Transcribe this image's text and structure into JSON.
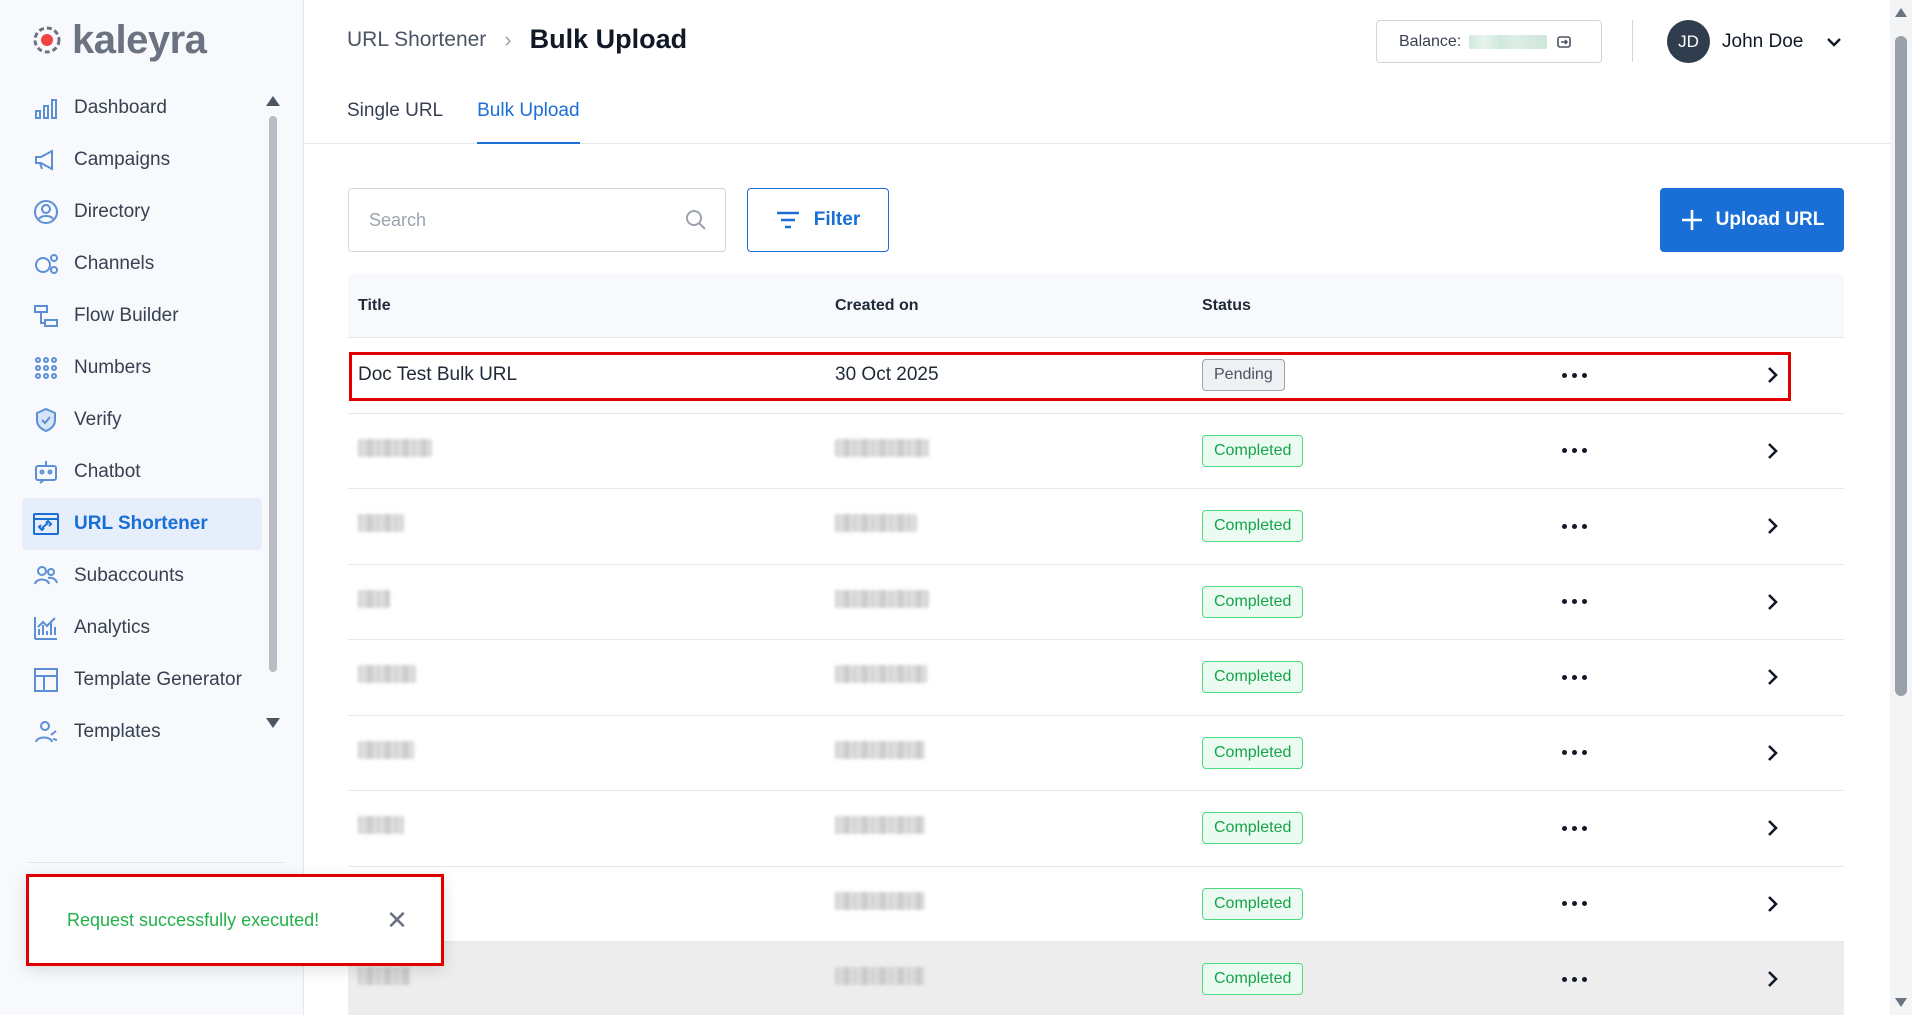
{
  "brand": {
    "name": "kaleyra",
    "accent": "#1a6fd6",
    "highlight": "#e00000"
  },
  "sidebar": {
    "items": [
      {
        "label": "Dashboard",
        "icon": "bar-chart-icon",
        "active": false
      },
      {
        "label": "Campaigns",
        "icon": "megaphone-icon",
        "active": false
      },
      {
        "label": "Directory",
        "icon": "person-circle-icon",
        "active": false
      },
      {
        "label": "Channels",
        "icon": "channels-icon",
        "active": false
      },
      {
        "label": "Flow Builder",
        "icon": "flow-icon",
        "active": false
      },
      {
        "label": "Numbers",
        "icon": "dialpad-icon",
        "active": false
      },
      {
        "label": "Verify",
        "icon": "shield-icon",
        "active": false
      },
      {
        "label": "Chatbot",
        "icon": "robot-icon",
        "active": false
      },
      {
        "label": "URL Shortener",
        "icon": "link-icon",
        "active": true
      },
      {
        "label": "Subaccounts",
        "icon": "users-icon",
        "active": false
      },
      {
        "label": "Analytics",
        "icon": "analytics-icon",
        "active": false
      },
      {
        "label": "Template Generator",
        "icon": "layout-icon",
        "active": false
      },
      {
        "label": "Templates",
        "icon": "templates-icon",
        "active": false
      }
    ]
  },
  "header": {
    "breadcrumb_parent": "URL Shortener",
    "breadcrumb_current": "Bulk Upload",
    "balance_label": "Balance:",
    "user_initials": "JD",
    "user_name": "John Doe"
  },
  "tabs": [
    {
      "label": "Single URL",
      "active": false
    },
    {
      "label": "Bulk Upload",
      "active": true
    }
  ],
  "toolbar": {
    "search_placeholder": "Search",
    "filter_label": "Filter",
    "upload_label": "Upload URL"
  },
  "table": {
    "columns": [
      "Title",
      "Created on",
      "Status"
    ],
    "rows": [
      {
        "title": "Doc Test Bulk URL",
        "created": "30 Oct 2025",
        "status": "Pending",
        "redacted": false
      },
      {
        "title": "",
        "created": "",
        "status": "Completed",
        "redacted": true
      },
      {
        "title": "",
        "created": "",
        "status": "Completed",
        "redacted": true
      },
      {
        "title": "",
        "created": "",
        "status": "Completed",
        "redacted": true
      },
      {
        "title": "",
        "created": "",
        "status": "Completed",
        "redacted": true
      },
      {
        "title": "",
        "created": "",
        "status": "Completed",
        "redacted": true
      },
      {
        "title": "",
        "created": "",
        "status": "Completed",
        "redacted": true
      },
      {
        "title": "",
        "created": "",
        "status": "Completed",
        "redacted": true
      },
      {
        "title": "",
        "created": "",
        "status": "Completed",
        "redacted": true
      }
    ]
  },
  "toast": {
    "message": "Request successfully executed!"
  }
}
